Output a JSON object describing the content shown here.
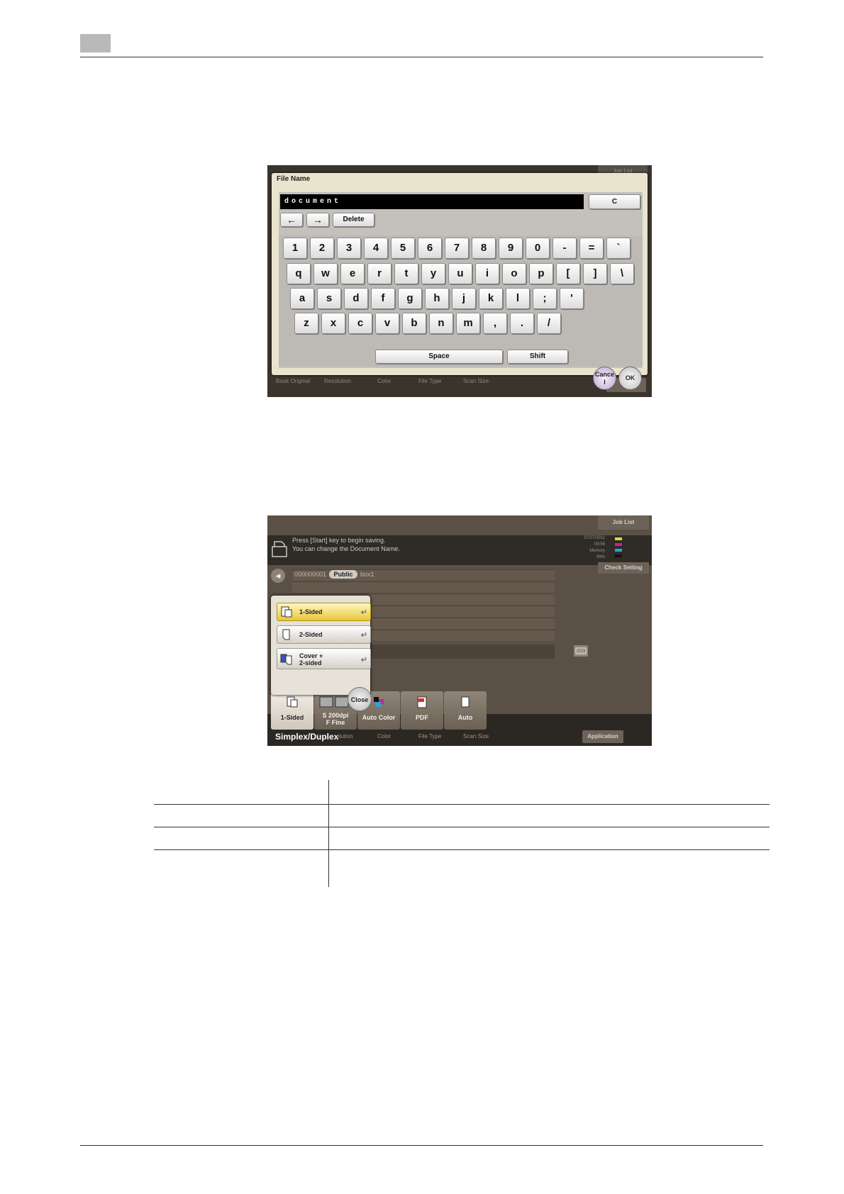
{
  "screen1": {
    "job_list": "Job List",
    "dialog_title": "File Name",
    "input_value": "document",
    "clear_label": "C",
    "left_arrow": "←",
    "right_arrow": "→",
    "delete_label": "Delete",
    "rows": [
      [
        "1",
        "2",
        "3",
        "4",
        "5",
        "6",
        "7",
        "8",
        "9",
        "0",
        "-",
        "=",
        "`"
      ],
      [
        "q",
        "w",
        "e",
        "r",
        "t",
        "y",
        "u",
        "i",
        "o",
        "p",
        "[",
        "]",
        "\\"
      ],
      [
        "a",
        "s",
        "d",
        "f",
        "g",
        "h",
        "j",
        "k",
        "l",
        ";",
        "'"
      ],
      [
        "z",
        "x",
        "c",
        "v",
        "b",
        "n",
        "m",
        ",",
        ".",
        "/"
      ]
    ],
    "space_label": "Space",
    "shift_label": "Shift",
    "cancel_label": "Cance\nl",
    "ok_label": "OK",
    "bottom_labels": [
      "Book Original",
      "Resolution",
      "Color",
      "File Type",
      "Scan Size"
    ],
    "app_partial": "Ap"
  },
  "screen2": {
    "job_list": "Job List",
    "message_line1": "Press [Start] key to begin saving.",
    "message_line2": "You can change the Document Name.",
    "status_lines": [
      "07/27/2011",
      "09:56",
      "Memory",
      "99%"
    ],
    "check_setting": "Check Setting",
    "box_number": "000000001",
    "box_type": "Public",
    "box_name": "box1",
    "options": [
      {
        "label": "1-Sided",
        "selected": true
      },
      {
        "label": "2-Sided",
        "selected": false
      },
      {
        "label": "Cover +\n2-sided",
        "selected": false
      }
    ],
    "close_label": "Close",
    "tiles": [
      {
        "label": "1-Sided"
      },
      {
        "label": "S 200dpi\nF Fine"
      },
      {
        "label": "Auto Color"
      },
      {
        "label": "PDF"
      },
      {
        "label": "Auto"
      }
    ],
    "bottom_labels": [
      "Simplex/Duplex",
      "Resolution",
      "Color",
      "File Type",
      "Scan Size"
    ],
    "resolution_partial": "olution",
    "application": "Application"
  }
}
